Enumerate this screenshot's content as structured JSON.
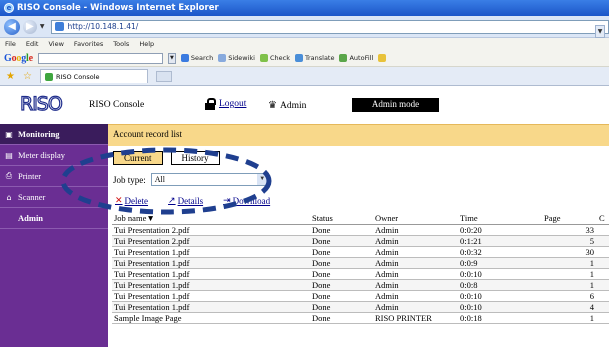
{
  "browser": {
    "window_title": "RISO Console - Windows Internet Explorer",
    "address": "http://10.148.1.41/",
    "menu": [
      "File",
      "Edit",
      "View",
      "Favorites",
      "Tools",
      "Help"
    ],
    "google_logo": "Google",
    "toolbar_items": [
      "Search",
      "Sidewiki",
      "Check",
      "Translate",
      "AutoFill"
    ],
    "tab_title": "RISO Console"
  },
  "header": {
    "logo": "RISO",
    "console_label": "RISO Console",
    "logout_label": "Logout",
    "user_label": "Admin",
    "mode_label": "Admin mode"
  },
  "sidebar": {
    "items": [
      {
        "label": "Monitoring",
        "icon": "monitor-icon",
        "active": true
      },
      {
        "label": "Meter display",
        "icon": "meter-icon"
      },
      {
        "label": "Printer",
        "icon": "printer-icon"
      },
      {
        "label": "Scanner",
        "icon": "scanner-icon"
      },
      {
        "label": "Admin",
        "icon": ""
      }
    ]
  },
  "main": {
    "section_title": "Account record list",
    "tabs": [
      {
        "label": "Current",
        "active": true
      },
      {
        "label": "History"
      }
    ],
    "job_type_label": "Job type:",
    "job_type_value": "All",
    "actions": {
      "delete": "Delete",
      "details": "Details",
      "download": "Download"
    },
    "columns": [
      "Job name▼",
      "Status",
      "Owner",
      "Time",
      "Page",
      "C"
    ],
    "rows": [
      {
        "name": "Tui Presentation 2.pdf",
        "status": "Done",
        "owner": "Admin",
        "time": "0:0:20",
        "page": "33"
      },
      {
        "name": "Tui Presentation 2.pdf",
        "status": "Done",
        "owner": "Admin",
        "time": "0:1:21",
        "page": "5"
      },
      {
        "name": "Tui Presentation 1.pdf",
        "status": "Done",
        "owner": "Admin",
        "time": "0:0:32",
        "page": "30"
      },
      {
        "name": "Tui Presentation 1.pdf",
        "status": "Done",
        "owner": "Admin",
        "time": "0:0:9",
        "page": "1"
      },
      {
        "name": "Tui Presentation 1.pdf",
        "status": "Done",
        "owner": "Admin",
        "time": "0:0:10",
        "page": "1"
      },
      {
        "name": "Tui Presentation 1.pdf",
        "status": "Done",
        "owner": "Admin",
        "time": "0:0:8",
        "page": "1"
      },
      {
        "name": "Tui Presentation 1.pdf",
        "status": "Done",
        "owner": "Admin",
        "time": "0:0:10",
        "page": "6"
      },
      {
        "name": "Tui Presentation 1.pdf",
        "status": "Done",
        "owner": "Admin",
        "time": "0:0:10",
        "page": "4"
      },
      {
        "name": "Sample Image Page",
        "status": "Done",
        "owner": "RISO PRINTER",
        "time": "0:0:18",
        "page": "1"
      }
    ]
  },
  "colors": {
    "sidebar_bg": "#6a2e93",
    "sidebar_active": "#3a1c5c",
    "section_bar": "#f8d88a",
    "annotation_ellipse": "#1f3f8f"
  }
}
